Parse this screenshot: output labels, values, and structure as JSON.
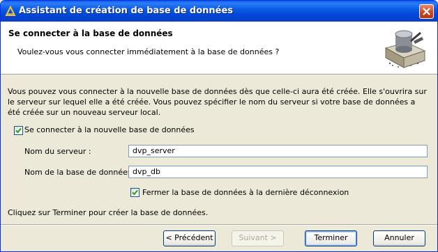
{
  "window": {
    "title": "Assistant de création de base de données",
    "icon": "database-wizard-icon",
    "close_icon": "close-icon"
  },
  "header": {
    "title": "Se connecter à la base de données",
    "subtitle": "Voulez-vous vous connecter immédiatement à la base de données ?",
    "graphic": "database-connect-icon"
  },
  "body": {
    "description": "Vous pouvez vous connecter à la nouvelle base de données dès que celle-ci aura été créée. Elle s'ouvrira sur le serveur sur lequel elle a été créée. Vous pouvez spécifier le nom du serveur si votre base de données a été créée sur un nouveau serveur local.",
    "connect_checkbox": {
      "label": "Se connecter à la nouvelle base de données",
      "checked": true
    },
    "server_name": {
      "label": "Nom du serveur :",
      "value": "dvp_server"
    },
    "database_name": {
      "label": "Nom de la base de données :",
      "value": "dvp_db"
    },
    "close_checkbox": {
      "label": "Fermer la base de données à la dernière déconnexion",
      "checked": true
    },
    "footer_note": "Cliquez sur Terminer pour créer la base de données."
  },
  "buttons": {
    "previous": "< Précédent",
    "next": "Suivant >",
    "finish": "Terminer",
    "cancel": "Annuler"
  },
  "colors": {
    "titlebar": "#0a5ce4",
    "dialog_bg": "#ece9d8",
    "checkmark": "#21a121"
  }
}
